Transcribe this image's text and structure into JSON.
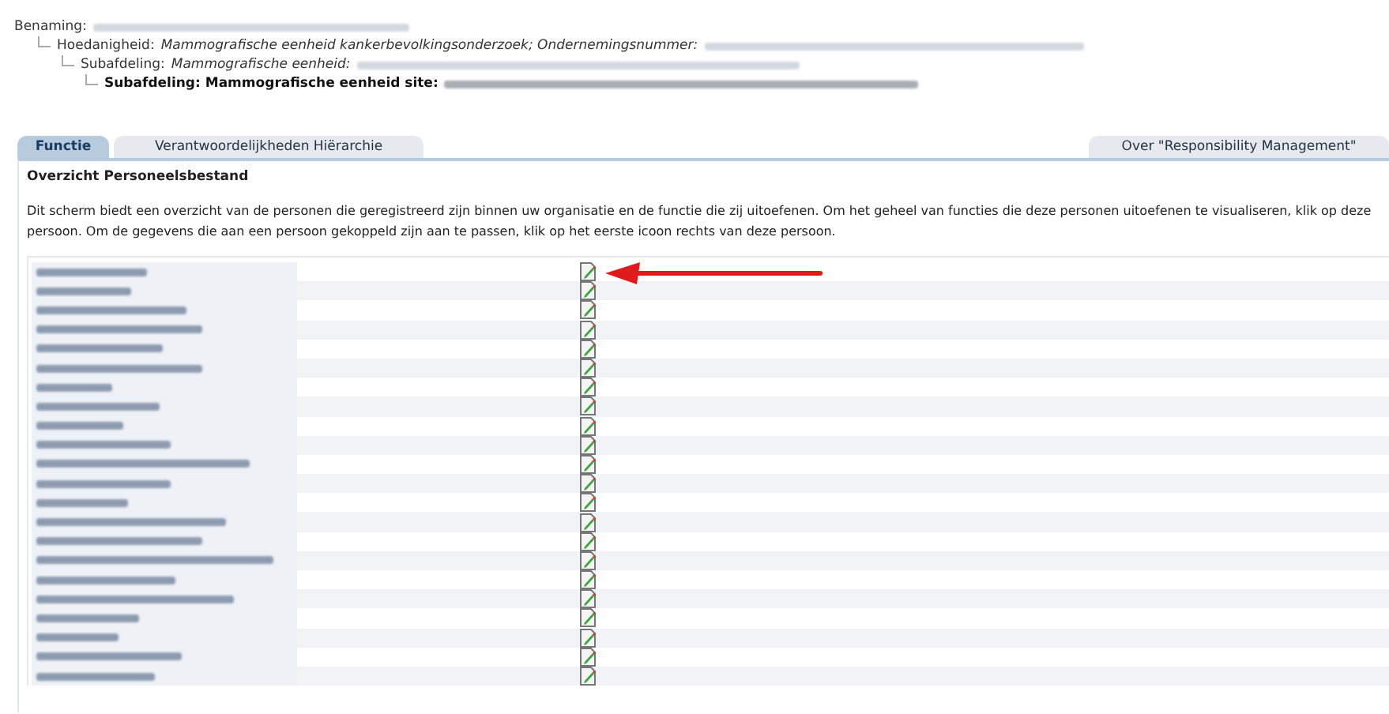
{
  "hierarchy": [
    {
      "label": "Benaming:",
      "children": [
        {
          "label": "Hoedanigheid:",
          "value": "Mammografische eenheid kankerbevolkingsonderzoek; Ondernemingsnummer:",
          "children": [
            {
              "label": "Subafdeling:",
              "value": "Mammografische eenheid:",
              "children": [
                {
                  "label": "Subafdeling: Mammografische eenheid site:"
                }
              ]
            }
          ]
        }
      ]
    }
  ],
  "tabs": [
    {
      "label": "Functie",
      "selected": true
    },
    {
      "label": "Verantwoordelijkheden Hiërarchie",
      "selected": false
    },
    {
      "label": "Over \"Responsibility Management\"",
      "selected": false
    }
  ],
  "panel": {
    "title": "Overzicht Personeelsbestand",
    "description": "Dit scherm biedt een overzicht van de personen die geregistreerd zijn binnen uw organisatie en de functie die zij uitoefenen. Om het geheel van functies die deze personen uitoefenen te visualiseren, klik op deze persoon. Om de gegevens die aan een persoon gekoppeld zijn aan te passen, klik op het eerste icoon rechts van deze persoon."
  },
  "people": [
    {
      "pointed": true
    },
    {
      "pointed": false
    },
    {
      "pointed": false
    },
    {
      "pointed": false
    },
    {
      "pointed": false
    },
    {
      "pointed": false
    },
    {
      "pointed": false
    },
    {
      "pointed": false
    },
    {
      "pointed": false
    },
    {
      "pointed": false
    },
    {
      "pointed": false
    },
    {
      "pointed": false
    },
    {
      "pointed": false
    },
    {
      "pointed": false
    },
    {
      "pointed": false
    },
    {
      "pointed": false
    },
    {
      "pointed": false
    },
    {
      "pointed": false
    },
    {
      "pointed": false
    },
    {
      "pointed": false
    },
    {
      "pointed": false
    },
    {
      "pointed": false
    }
  ]
}
